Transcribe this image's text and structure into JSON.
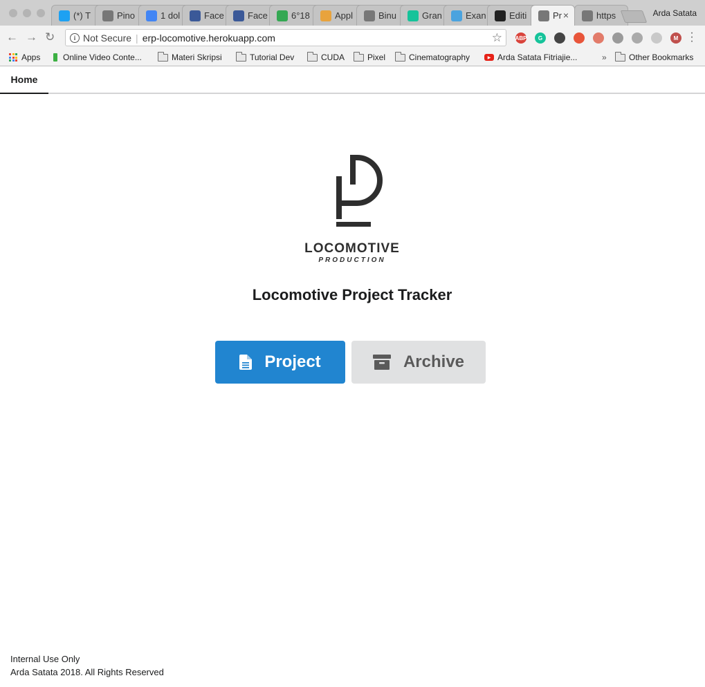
{
  "browser": {
    "profile_name": "Arda Satata",
    "tabs": [
      {
        "title": "(*) T",
        "icon": "twitter-icon",
        "color": "#1da1f2"
      },
      {
        "title": "Pino",
        "icon": "page-icon",
        "color": "#777777"
      },
      {
        "title": "1 dol",
        "icon": "google-icon",
        "color": "#4285f4"
      },
      {
        "title": "Face",
        "icon": "facebook-icon",
        "color": "#3b5998"
      },
      {
        "title": "Face",
        "icon": "facebook-icon",
        "color": "#3b5998"
      },
      {
        "title": "6°18",
        "icon": "maps-icon",
        "color": "#34a853"
      },
      {
        "title": "Appl",
        "icon": "app-icon",
        "color": "#e8a33d"
      },
      {
        "title": "Binu",
        "icon": "page-icon",
        "color": "#777777"
      },
      {
        "title": "Gran",
        "icon": "grammarly-icon",
        "color": "#15c39a"
      },
      {
        "title": "Exan",
        "icon": "exam-icon",
        "color": "#4aa3df"
      },
      {
        "title": "Editi",
        "icon": "github-icon",
        "color": "#222222"
      },
      {
        "title": "Pr",
        "icon": "page-icon",
        "color": "#777777",
        "active": true
      },
      {
        "title": "https",
        "icon": "page-icon",
        "color": "#777777"
      }
    ],
    "address": {
      "security_label": "Not Secure",
      "url": "erp-locomotive.herokuapp.com"
    },
    "extensions": [
      {
        "name": "adblock-icon",
        "label": "ABP",
        "color": "#d9433b"
      },
      {
        "name": "grammarly-ext-icon",
        "label": "G",
        "color": "#15c39a"
      },
      {
        "name": "ext-dark-icon",
        "label": "",
        "color": "#444444"
      },
      {
        "name": "ext-red-icon",
        "label": "",
        "color": "#e8553a"
      },
      {
        "name": "ext-ring-icon",
        "label": "",
        "color": "#e27b6a"
      },
      {
        "name": "ext-gray-icon",
        "label": "",
        "color": "#9a9a9a"
      },
      {
        "name": "ext-block-icon",
        "label": "",
        "color": "#aaaaaa"
      },
      {
        "name": "ext-gear-icon",
        "label": "",
        "color": "#c9c9c9"
      },
      {
        "name": "ext-m-icon",
        "label": "M",
        "color": "#c0504d"
      }
    ],
    "bookmarks": [
      {
        "label": "Apps",
        "icon": "apps-icon"
      },
      {
        "label": "Online Video Conte...",
        "icon": "battery-icon"
      },
      {
        "label": "Materi Skripsi",
        "icon": "folder-icon"
      },
      {
        "label": "Tutorial Dev",
        "icon": "folder-icon"
      },
      {
        "label": "CUDA",
        "icon": "folder-icon"
      },
      {
        "label": "Pixel",
        "icon": "folder-icon"
      },
      {
        "label": "Cinematography",
        "icon": "folder-icon"
      },
      {
        "label": "Arda Satata Fitriajie...",
        "icon": "youtube-icon"
      }
    ],
    "bookmarks_overflow": "»",
    "other_bookmarks": "Other Bookmarks"
  },
  "nav": {
    "home_label": "Home"
  },
  "brand": {
    "name": "LOCOMOTIVE",
    "tagline": "PRODUCTION"
  },
  "main": {
    "title": "Locomotive Project Tracker",
    "project_button": "Project",
    "archive_button": "Archive"
  },
  "footer": {
    "line1": "Internal Use Only",
    "line2": "Arda Satata 2018. All Rights Reserved"
  },
  "colors": {
    "primary": "#2185d0",
    "secondary": "#e0e1e2",
    "logo": "#2e2e2e"
  }
}
